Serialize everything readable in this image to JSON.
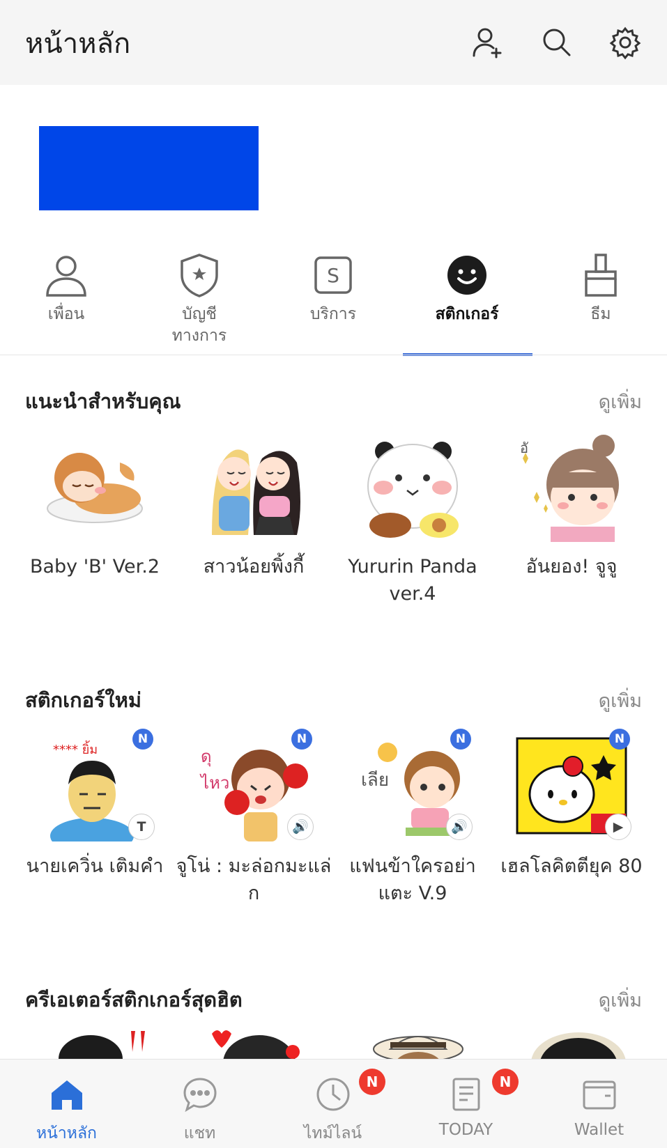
{
  "header": {
    "title": "หน้าหลัก",
    "add_friend_icon": "add-friend-icon",
    "search_icon": "search-icon",
    "settings_icon": "gear-icon"
  },
  "banner": {
    "color": "#0046e8"
  },
  "tabs": [
    {
      "label": "เพื่อน",
      "icon": "person-icon",
      "active": false
    },
    {
      "label": "บัญชี\nทางการ",
      "icon": "shield-star-icon",
      "active": false
    },
    {
      "label": "บริการ",
      "icon": "service-s-icon",
      "active": false
    },
    {
      "label": "สติกเกอร์",
      "icon": "smiley-icon",
      "active": true
    },
    {
      "label": "ธีม",
      "icon": "brush-icon",
      "active": false
    }
  ],
  "sections": {
    "recommended": {
      "title": "แนะนำสำหรับคุณ",
      "see_more": "ดูเพิ่ม",
      "items": [
        {
          "name": "Baby 'B' Ver.2"
        },
        {
          "name": "สาวน้อยพิ้งกี้"
        },
        {
          "name": "Yururin Panda ver.4"
        },
        {
          "name": "อันยอง! จูจู"
        }
      ]
    },
    "new_stickers": {
      "title": "สติกเกอร์ใหม่",
      "see_more": "ดูเพิ่ม",
      "items": [
        {
          "name": "นายเควิ่น เติมคำ",
          "new_badge": "N",
          "type_badge": "T"
        },
        {
          "name": "จูโน่ : มะล่อกมะแล่ก",
          "new_badge": "N",
          "type_badge": "🔊"
        },
        {
          "name": "แฟนข้าใครอย่าแตะ V.9",
          "new_badge": "N",
          "type_badge": "🔊"
        },
        {
          "name": "เฮลโลคิตตียุค 80",
          "new_badge": "N",
          "type_badge": "▶"
        }
      ]
    },
    "creators": {
      "title": "ครีเอเตอร์สติกเกอร์สุดฮิต",
      "see_more": "ดูเพิ่ม"
    }
  },
  "bottom_nav": [
    {
      "label": "หน้าหลัก",
      "icon": "home-icon",
      "active": true
    },
    {
      "label": "แชท",
      "icon": "chat-icon",
      "active": false
    },
    {
      "label": "ไทม์ไลน์",
      "icon": "clock-icon",
      "active": false,
      "badge": "N"
    },
    {
      "label": "TODAY",
      "icon": "news-icon",
      "active": false,
      "badge": "N"
    },
    {
      "label": "Wallet",
      "icon": "wallet-icon",
      "active": false
    }
  ],
  "colors": {
    "accent": "#3f6fd8",
    "badge_red": "#ee3a2e",
    "badge_blue": "#3b6fe0"
  }
}
